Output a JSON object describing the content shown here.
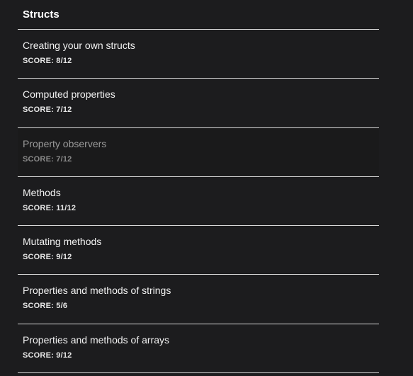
{
  "section": {
    "title": "Structs"
  },
  "items": [
    {
      "title": "Creating your own structs",
      "score_label": "SCORE:",
      "score": "8/12",
      "dimmed": false
    },
    {
      "title": "Computed properties",
      "score_label": "SCORE:",
      "score": "7/12",
      "dimmed": false
    },
    {
      "title": "Property observers",
      "score_label": "SCORE:",
      "score": "7/12",
      "dimmed": true
    },
    {
      "title": "Methods",
      "score_label": "SCORE:",
      "score": "11/12",
      "dimmed": false
    },
    {
      "title": "Mutating methods",
      "score_label": "SCORE:",
      "score": "9/12",
      "dimmed": false
    },
    {
      "title": "Properties and methods of strings",
      "score_label": "SCORE:",
      "score": "5/6",
      "dimmed": false
    },
    {
      "title": "Properties and methods of arrays",
      "score_label": "SCORE:",
      "score": "9/12",
      "dimmed": false
    }
  ],
  "colors": {
    "background": "#1c1c1e",
    "separator": "#d8d8d8",
    "dimmed_text": "#9a9a9a"
  }
}
